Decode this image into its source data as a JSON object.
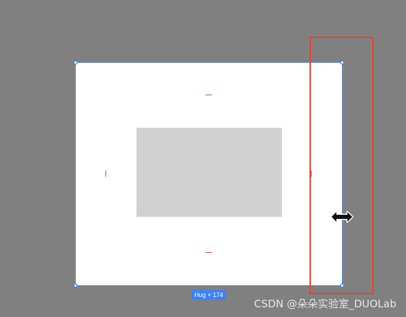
{
  "canvas": {
    "background_color": "#808080"
  },
  "frame": {
    "fill_color": "#ffffff",
    "selection_color": "#3b82f6",
    "size_badge": "Hug × 174"
  },
  "child_rect": {
    "fill_color": "#d1d1d1"
  },
  "padding_indicator_color": "#d0357a",
  "annotation": {
    "highlight_color": "#e5432c"
  },
  "cursor": {
    "icon": "horizontal-resize-cursor-icon"
  },
  "watermark": {
    "text": "CSDN @朵朵实验室_DUOLab"
  }
}
